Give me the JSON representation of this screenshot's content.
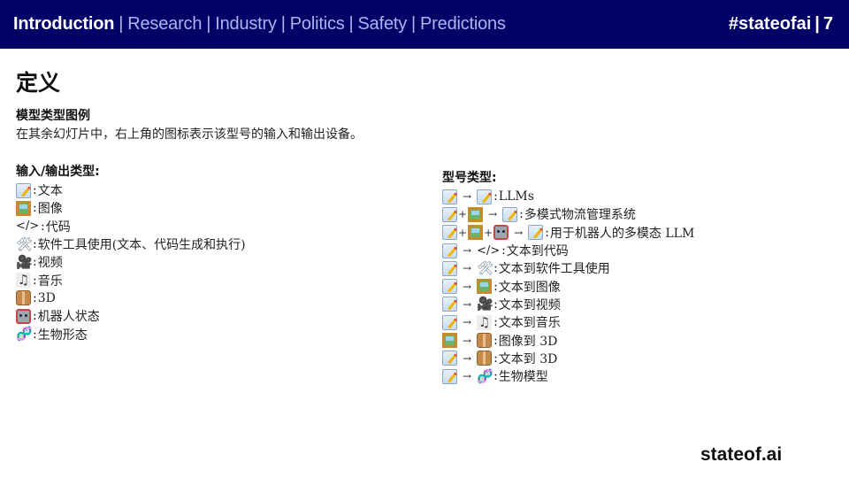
{
  "header": {
    "nav": [
      {
        "label": "Introduction",
        "active": true
      },
      {
        "label": "Research",
        "active": false
      },
      {
        "label": "Industry",
        "active": false
      },
      {
        "label": "Politics",
        "active": false
      },
      {
        "label": "Safety",
        "active": false
      },
      {
        "label": "Predictions",
        "active": false
      }
    ],
    "separator": "|",
    "hashtag": "#stateofai",
    "page_number": "7"
  },
  "title": "定义",
  "legend": {
    "heading": "模型类型图例",
    "description": "在其余幻灯片中，右上角的图标表示该型号的输入和输出设备。"
  },
  "io_types": {
    "heading": "输入/输出类型:",
    "items": [
      {
        "icon": "text-icon",
        "label": "文本"
      },
      {
        "icon": "image-icon",
        "label": "图像"
      },
      {
        "icon": "code-icon",
        "glyph": "</>",
        "label": "代码"
      },
      {
        "icon": "tools-icon",
        "glyph": "🛠",
        "label": "软件工具使用(文本、代码生成和执行)"
      },
      {
        "icon": "video-camera-icon",
        "glyph": "🎥",
        "label": "视频"
      },
      {
        "icon": "music-icon",
        "glyph": "♫",
        "label": "音乐"
      },
      {
        "icon": "box-3d-icon",
        "label": "3D"
      },
      {
        "icon": "robot-icon",
        "label": "机器人状态"
      },
      {
        "icon": "dna-icon",
        "glyph": "🧬",
        "label": "生物形态"
      }
    ]
  },
  "model_types": {
    "heading": "型号类型:",
    "arrow": "→",
    "plus": "+",
    "items": [
      {
        "label": "LLMs"
      },
      {
        "label": "多模式物流管理系统"
      },
      {
        "label": "用于机器人的多模态 LLM"
      },
      {
        "label": "文本到代码"
      },
      {
        "label": "文本到软件工具使用"
      },
      {
        "label": "文本到图像"
      },
      {
        "label": "文本到视频"
      },
      {
        "label": "文本到音乐"
      },
      {
        "label": "图像到 3D"
      },
      {
        "label": "文本到 3D"
      },
      {
        "label": "生物模型"
      }
    ]
  },
  "glyphs": {
    "code": "</>",
    "tools": "🛠",
    "video": "🎥",
    "music": "♫",
    "dna": "🧬",
    "colon": ":"
  },
  "footer": {
    "brand": "stateof.ai"
  },
  "colors": {
    "header_bg": "#000066",
    "nav_inactive": "#a9b6f0",
    "nav_active": "#ffffff"
  }
}
